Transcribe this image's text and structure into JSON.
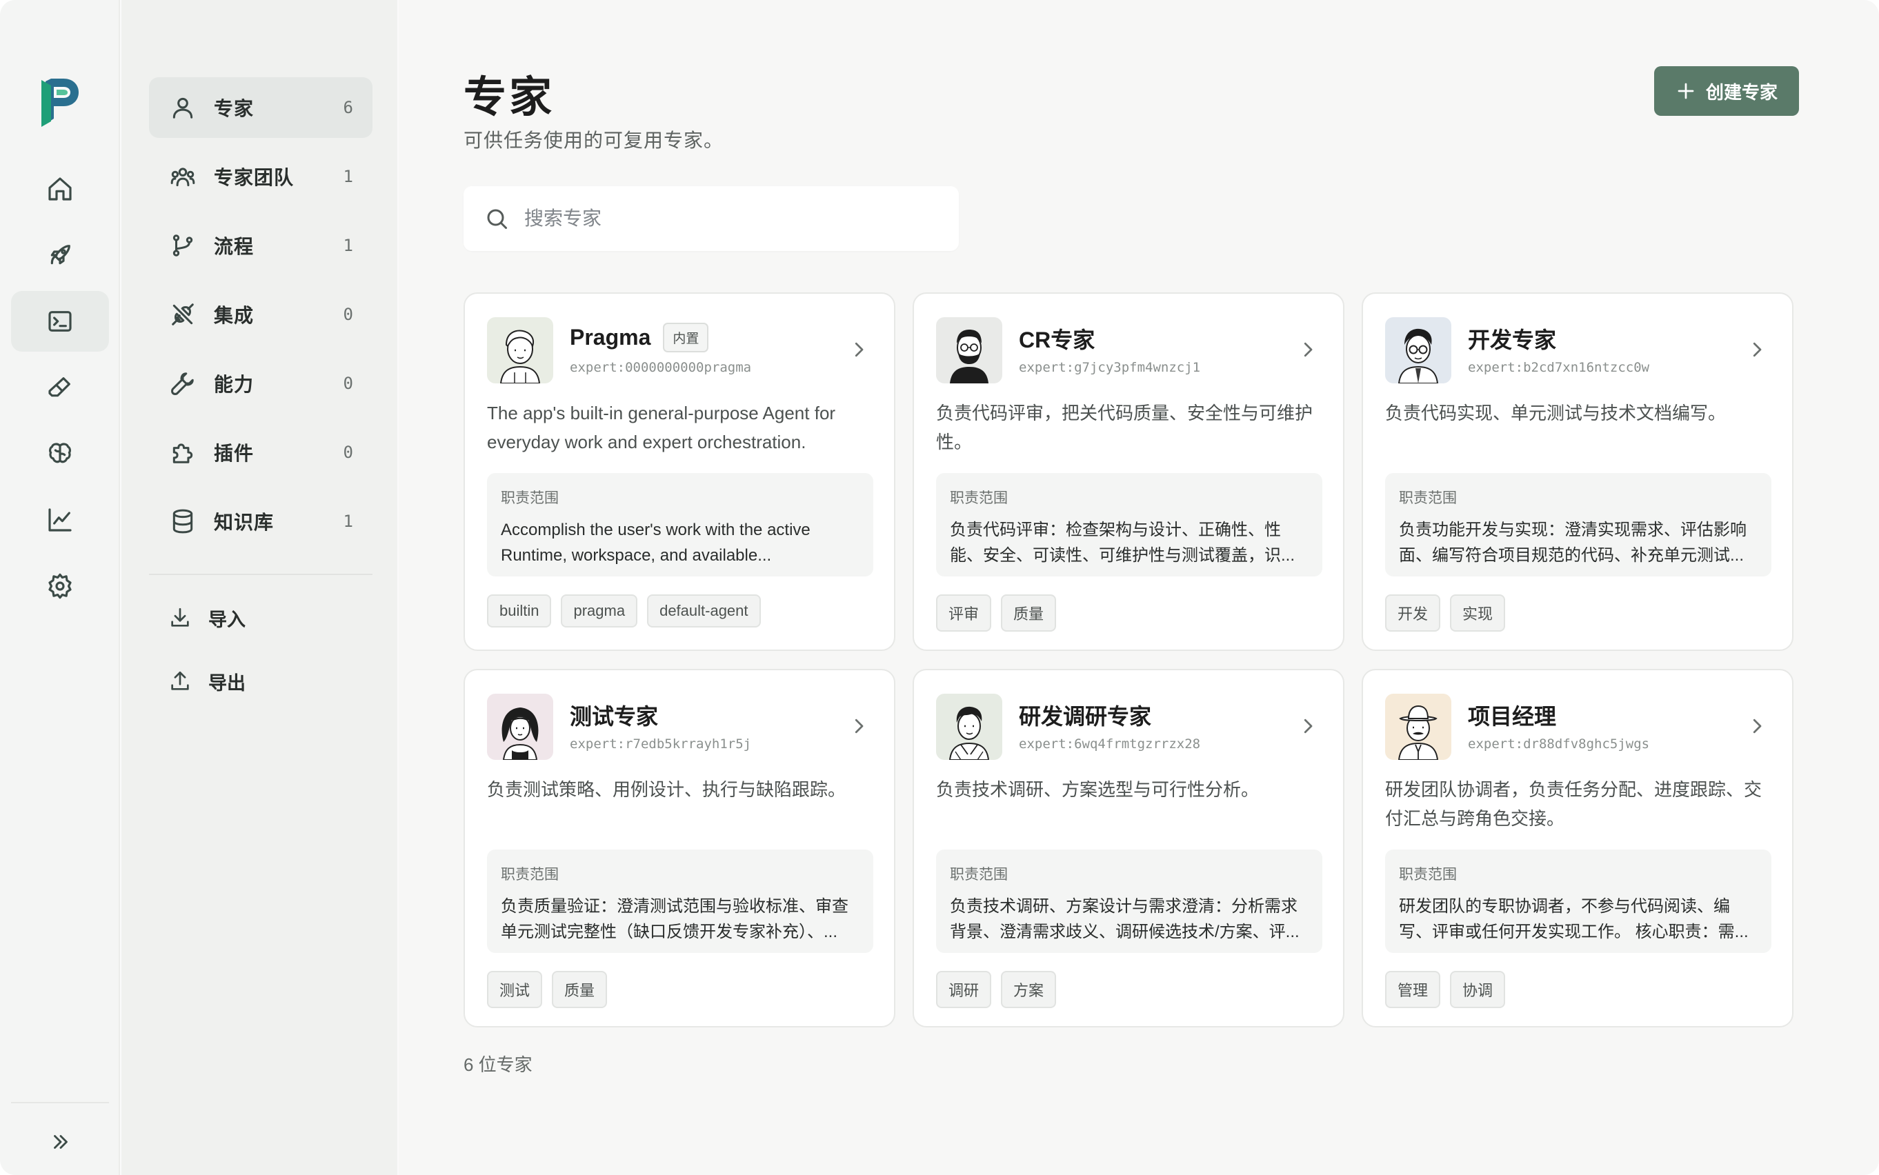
{
  "sidebar": {
    "items": [
      {
        "label": "专家",
        "count": "6",
        "icon": "user-icon"
      },
      {
        "label": "专家团队",
        "count": "1",
        "icon": "users-icon"
      },
      {
        "label": "流程",
        "count": "1",
        "icon": "git-branch-icon"
      },
      {
        "label": "集成",
        "count": "0",
        "icon": "plug-icon"
      },
      {
        "label": "能力",
        "count": "0",
        "icon": "wrench-icon"
      },
      {
        "label": "插件",
        "count": "0",
        "icon": "puzzle-icon"
      },
      {
        "label": "知识库",
        "count": "1",
        "icon": "database-icon"
      }
    ],
    "actions": [
      {
        "label": "导入",
        "icon": "import-icon"
      },
      {
        "label": "导出",
        "icon": "export-icon"
      }
    ]
  },
  "rail": {
    "icons": [
      "app-logo",
      "home-icon",
      "rocket-icon",
      "terminal-icon",
      "eraser-icon",
      "brain-icon",
      "chart-icon",
      "settings-icon",
      "expand-icon"
    ]
  },
  "header": {
    "title": "专家",
    "subtitle": "可供任务使用的可复用专家。",
    "create_label": "创建专家"
  },
  "search": {
    "placeholder": "搜索专家"
  },
  "experts": [
    {
      "name": "Pragma",
      "badge": "内置",
      "id": "expert:0000000000pragma",
      "description": "The app's built-in general-purpose Agent for everyday work and expert orchestration.",
      "scope_label": "职责范围",
      "scope": "Accomplish the user's work with the active Runtime, workspace, and available...",
      "tags": [
        "builtin",
        "pragma",
        "default-agent"
      ]
    },
    {
      "name": "CR专家",
      "badge": "",
      "id": "expert:g7jcy3pfm4wnzcj1",
      "description": "负责代码评审，把关代码质量、安全性与可维护性。",
      "scope_label": "职责范围",
      "scope": "负责代码评审：检查架构与设计、正确性、性能、安全、可读性、可维护性与测试覆盖，识...",
      "tags": [
        "评审",
        "质量"
      ]
    },
    {
      "name": "开发专家",
      "badge": "",
      "id": "expert:b2cd7xn16ntzcc0w",
      "description": "负责代码实现、单元测试与技术文档编写。",
      "scope_label": "职责范围",
      "scope": "负责功能开发与实现：澄清实现需求、评估影响面、编写符合项目规范的代码、补充单元测试...",
      "tags": [
        "开发",
        "实现"
      ]
    },
    {
      "name": "测试专家",
      "badge": "",
      "id": "expert:r7edb5krrayh1r5j",
      "description": "负责测试策略、用例设计、执行与缺陷跟踪。",
      "scope_label": "职责范围",
      "scope": "负责质量验证：澄清测试范围与验收标准、审查单元测试完整性（缺口反馈开发专家补充）、...",
      "tags": [
        "测试",
        "质量"
      ]
    },
    {
      "name": "研发调研专家",
      "badge": "",
      "id": "expert:6wq4frmtgzrrzx28",
      "description": "负责技术调研、方案选型与可行性分析。",
      "scope_label": "职责范围",
      "scope": "负责技术调研、方案设计与需求澄清：分析需求背景、澄清需求歧义、调研候选技术/方案、评...",
      "tags": [
        "调研",
        "方案"
      ]
    },
    {
      "name": "项目经理",
      "badge": "",
      "id": "expert:dr88dfv8ghc5jwgs",
      "description": "研发团队协调者，负责任务分配、进度跟踪、交付汇总与跨角色交接。",
      "scope_label": "职责范围",
      "scope": "研发团队的专职协调者，不参与代码阅读、编写、评审或任何开发实现工作。 核心职责：需...",
      "tags": [
        "管理",
        "协调"
      ]
    }
  ],
  "footer": {
    "count_text": "6 位专家"
  },
  "colors": {
    "accent": "#5a7a69",
    "logo_green": "#1f8f72",
    "logo_teal": "#2a6f8f"
  }
}
